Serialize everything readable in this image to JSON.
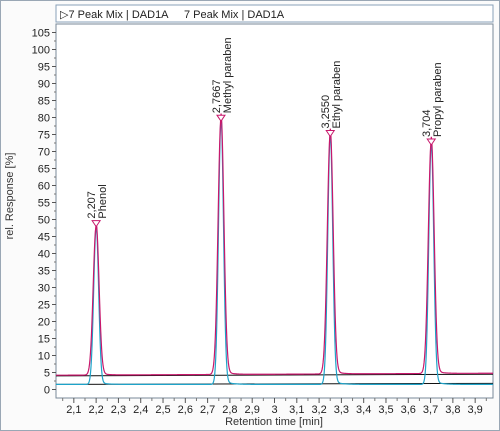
{
  "chart_data": {
    "type": "line",
    "xlabel": "Retention time [min]",
    "ylabel": "rel. Response [%]",
    "xlim": [
      2.02,
      3.98
    ],
    "ylim": [
      -2.5,
      107.5
    ],
    "x_ticks": [
      2.1,
      2.2,
      2.3,
      2.4,
      2.5,
      2.6,
      2.7,
      2.8,
      2.9,
      3.0,
      3.1,
      3.2,
      3.3,
      3.4,
      3.5,
      3.6,
      3.7,
      3.8,
      3.9
    ],
    "x_tick_labels": [
      "2,1",
      "2,2",
      "2,3",
      "2,4",
      "2,5",
      "2,6",
      "2,7",
      "2,8",
      "2,9",
      "3",
      "3,1",
      "3,2",
      "3,3",
      "3,4",
      "3,5",
      "3,6",
      "3,7",
      "3,8",
      "3,9"
    ],
    "y_ticks": [
      0,
      5,
      10,
      15,
      20,
      25,
      30,
      35,
      40,
      45,
      50,
      55,
      60,
      65,
      70,
      75,
      80,
      85,
      90,
      95,
      100,
      105
    ],
    "grid": false,
    "legend_placement": "top-left",
    "series": [
      {
        "name": "7 Peak Mix | DAD1A",
        "color": "#1ea3c9",
        "legend_marker": "▷",
        "baseline": 1.5,
        "peaks": [
          {
            "x": 2.2,
            "height": 47.5,
            "width": 0.011
          },
          {
            "x": 2.76,
            "height": 79.0,
            "width": 0.011
          },
          {
            "x": 3.25,
            "height": 74.5,
            "width": 0.011
          },
          {
            "x": 3.703,
            "height": 72.0,
            "width": 0.011
          }
        ]
      },
      {
        "name": "7 Peak Mix | DAD1A",
        "color": "#c8186c",
        "legend_marker": "",
        "baseline": 4.2,
        "peaks": [
          {
            "x": 2.2,
            "height": 48.0,
            "width": 0.013
          },
          {
            "x": 2.76,
            "height": 79.5,
            "width": 0.013
          },
          {
            "x": 3.25,
            "height": 75.0,
            "width": 0.013
          },
          {
            "x": 3.703,
            "height": 72.5,
            "width": 0.013
          }
        ]
      }
    ],
    "baselines": [
      {
        "color": "#111111",
        "y_start": 4.0,
        "y_end": 4.5
      },
      {
        "color": "#111111",
        "y_start": 1.5,
        "y_end": 1.8
      }
    ],
    "annotations": [
      {
        "x": 2.2,
        "y": 48.5,
        "time": "2,207",
        "name": "Phenol"
      },
      {
        "x": 2.76,
        "y": 79.5,
        "time": "2,7667",
        "name": "Methyl paraben"
      },
      {
        "x": 3.25,
        "y": 75.0,
        "time": "3,2550",
        "name": "Ethyl paraben"
      },
      {
        "x": 3.703,
        "y": 72.5,
        "time": "3,704",
        "name": "Propyl paraben"
      }
    ]
  }
}
